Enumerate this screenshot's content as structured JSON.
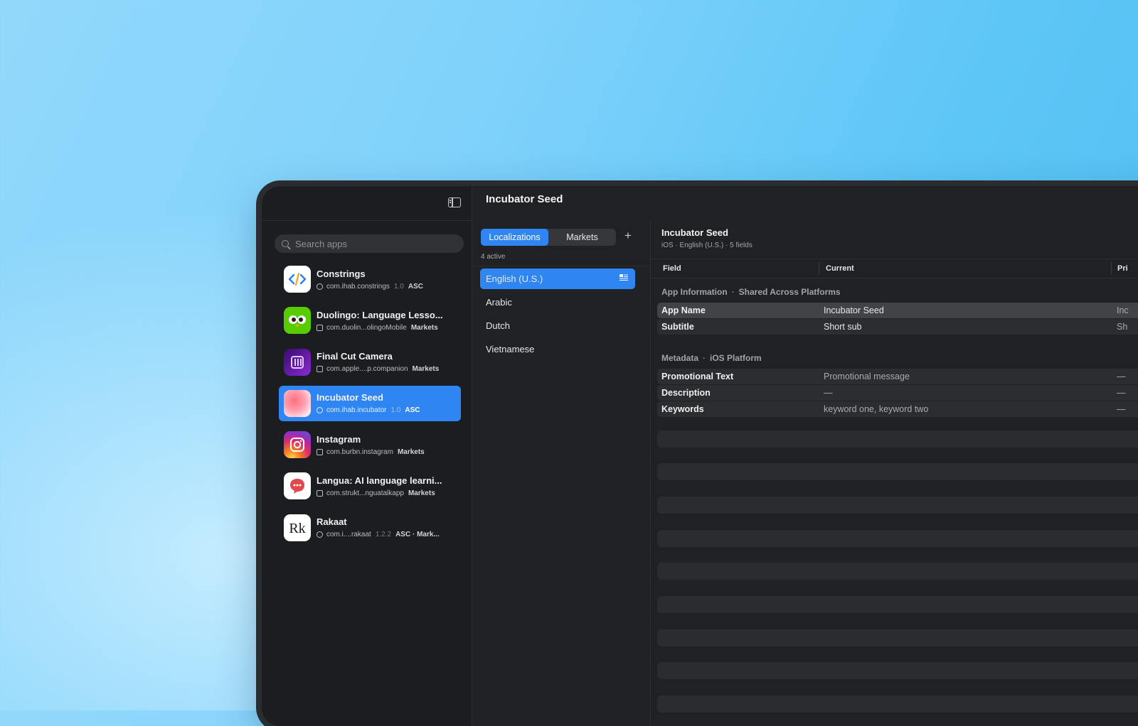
{
  "window_title": "Incubator Seed",
  "sidebar": {
    "search_placeholder": "Search apps",
    "apps": [
      {
        "name": "Constrings",
        "bundle": "com.ihab.constrings",
        "version": "1.0",
        "source": "ASC",
        "meta_icon": "globe-icon",
        "icon": "code-icon",
        "selected": false
      },
      {
        "name": "Duolingo: Language Lesso...",
        "bundle": "com.duolin...olingoMobile",
        "version": "",
        "source": "Markets",
        "meta_icon": "bag-icon",
        "icon": "owl-icon",
        "selected": false
      },
      {
        "name": "Final Cut Camera",
        "bundle": "com.apple....p.companion",
        "version": "",
        "source": "Markets",
        "meta_icon": "bag-icon",
        "icon": "camera-icon",
        "selected": false
      },
      {
        "name": "Incubator Seed",
        "bundle": "com.ihab.incubator",
        "version": "1.0",
        "source": "ASC",
        "meta_icon": "globe-icon",
        "icon": "gradient-icon",
        "selected": true
      },
      {
        "name": "Instagram",
        "bundle": "com.burbn.instagram",
        "version": "",
        "source": "Markets",
        "meta_icon": "bag-icon",
        "icon": "instagram-icon",
        "selected": false
      },
      {
        "name": "Langua: AI language learni...",
        "bundle": "com.strukt...nguatalkapp",
        "version": "",
        "source": "Markets",
        "meta_icon": "bag-icon",
        "icon": "chat-icon",
        "selected": false
      },
      {
        "name": "Rakaat",
        "bundle": "com.i....rakaat",
        "version": "1.2.2",
        "source": "ASC · Mark...",
        "meta_icon": "link-icon",
        "icon": "rk-icon",
        "selected": false
      }
    ]
  },
  "locales": {
    "tabs": [
      "Localizations",
      "Markets"
    ],
    "active_tab": "Localizations",
    "add_label": "+",
    "active_count": "4 active",
    "items": [
      "English (U.S.)",
      "Arabic",
      "Dutch",
      "Vietnamese"
    ],
    "selected": "English (U.S.)"
  },
  "detail": {
    "title": "Incubator Seed",
    "subtitle": "iOS · English (U.S.) · 5 fields",
    "columns": [
      "Field",
      "Current",
      "Pri"
    ],
    "sections": [
      {
        "title": "App Information",
        "subtitle": "Shared Across Platforms",
        "rows": [
          {
            "field": "App Name",
            "current": "Incubator Seed",
            "previous": "Inc"
          },
          {
            "field": "Subtitle",
            "current": "Short sub",
            "previous": "Sh"
          }
        ]
      },
      {
        "title": "Metadata",
        "subtitle": "iOS Platform",
        "rows": [
          {
            "field": "Promotional Text",
            "current": "Promotional message",
            "previous": "—"
          },
          {
            "field": "Description",
            "current": "—",
            "previous": "—"
          },
          {
            "field": "Keywords",
            "current": "keyword one, keyword two",
            "previous": "—"
          }
        ]
      }
    ]
  },
  "colors": {
    "accent": "#2f86f2",
    "window_bg": "#1f2124",
    "sidebar_bg": "#1b1d20"
  }
}
